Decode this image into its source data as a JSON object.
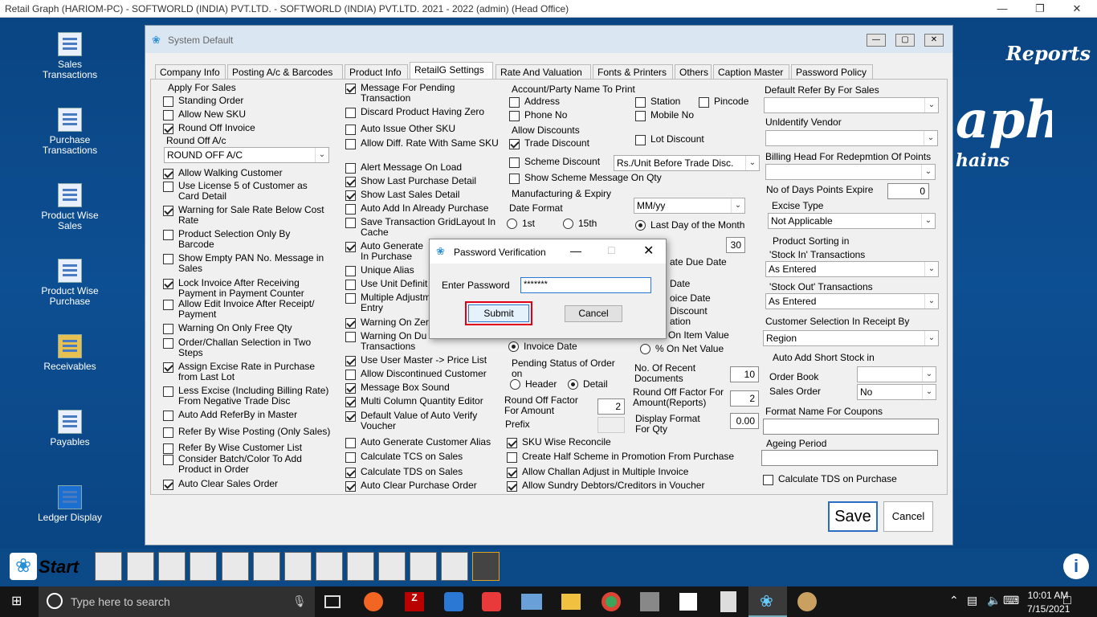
{
  "window": {
    "title": "Retail Graph (HARIOM-PC) - SOFTWORLD (INDIA) PVT.LTD. - SOFTWORLD (INDIA) PVT.LTD.  2021 - 2022 (admin) (Head Office)"
  },
  "desktop": {
    "icons": [
      {
        "label": "Sales Transactions",
        "icon": "document-icon"
      },
      {
        "label": "Purchase Transactions",
        "icon": "document-icon"
      },
      {
        "label": "Product Wise Sales",
        "icon": "document-icon"
      },
      {
        "label": "Product Wise Purchase",
        "icon": "document-icon"
      },
      {
        "label": "Receivables",
        "icon": "coins-icon"
      },
      {
        "label": "Payables",
        "icon": "grid-icon"
      },
      {
        "label": "Ledger Display",
        "icon": "ledger-icon"
      }
    ],
    "brand": "Reports",
    "bigtext": "aph",
    "subtext": "hains"
  },
  "dialog": {
    "title": "System Default",
    "tabs": [
      "Company Info",
      "Posting A/c & Barcodes",
      "Product Info",
      "RetailG Settings",
      "Rate And Valuation",
      "Fonts & Printers",
      "Others",
      "Caption Master",
      "Password Policy"
    ],
    "col1": {
      "apply_for_sales": "Apply For Sales",
      "standing_order": "Standing Order",
      "allow_new_sku": "Allow New SKU",
      "round_off_invoice": "Round Off Invoice",
      "round_off_ac": "Round Off A/c",
      "round_off_ac_value": "ROUND OFF A/C",
      "allow_walking": "Allow Walking Customer",
      "use_license": "Use License 5 of Customer as Card Detail",
      "warning_sale_rate": "Warning for Sale Rate Below Cost Rate",
      "product_selection": "Product Selection Only By Barcode",
      "show_empty_pan": "Show Empty PAN No. Message in Sales",
      "lock_invoice": "Lock Invoice After Receiving Payment in Payment Counter",
      "allow_edit_invoice": "Allow Edit Invoice After Receipt/ Payment",
      "warning_free_qty": "Warning On Only Free Qty",
      "order_challan": "Order/Challan Selection in Two Steps",
      "assign_excise": "Assign Excise Rate in Purchase from Last Lot",
      "less_excise": "Less Excise (Including Billing Rate) From Negative Trade Disc",
      "auto_add_referby": "Auto Add ReferBy in Master",
      "refer_by_wise": "Refer By Wise Posting (Only Sales)",
      "refer_customer_list": "Refer By Wise Customer List",
      "consider_batch": "Consider Batch/Color To Add Product in Order",
      "auto_clear_sales": "Auto Clear Sales Order"
    },
    "col2": {
      "msg_pending": "Message For Pending Transaction",
      "discard_product": "Discard Product Having Zero",
      "auto_issue_sku": "Auto Issue Other SKU",
      "allow_diff_rate": "Allow Diff. Rate With Same SKU",
      "alert_on_load": "Alert Message On Load",
      "show_last_purchase": "Show Last Purchase Detail",
      "show_last_sales": "Show Last Sales Detail",
      "auto_add_purchase": "Auto Add In Already Purchase",
      "save_grid": "Save Transaction GridLayout In Cache",
      "auto_generate": "Auto Generate In Purchase",
      "unique_alias": "Unique Alias",
      "use_unit": "Use Unit Definit",
      "multiple_adjust": "Multiple Adjustm Entry",
      "warning_zero": "Warning On Zer",
      "warning_du": "Warning On Du in Transactions",
      "user_master": "Use User Master -> Price List",
      "allow_discontinued": "Allow Discontinued Customer",
      "msg_box_sound": "Message Box Sound",
      "multi_column": "Multi Column Quantity Editor",
      "default_auto_verify": "Default Value of Auto Verify Voucher",
      "auto_gen_alias": "Auto Generate Customer Alias",
      "calc_tcs": "Calculate TCS on Sales",
      "calc_tds": "Calculate TDS on Sales",
      "auto_clear_purchase": "Auto Clear Purchase Order"
    },
    "col3": {
      "acct_party": "Account/Party Name To Print",
      "address": "Address",
      "station": "Station",
      "pincode": "Pincode",
      "phone": "Phone No",
      "mobile": "Mobile No",
      "allow_discounts": "Allow Discounts",
      "trade_discount": "Trade Discount",
      "lot_discount": "Lot Discount",
      "scheme_discount": "Scheme Discount",
      "scheme_discount_value": "Rs./Unit Before Trade Disc.",
      "show_scheme": "Show Scheme Message On Qty",
      "mfg_expiry": "Manufacturing & Expiry",
      "date_format": "Date Format",
      "date_format_value": "MM/yy",
      "r1st": "1st",
      "r15th": "15th",
      "last_day": "Last  Day of the Month",
      "days_value": "30",
      "ate_due_date": "ate Due Date",
      "date": "Date",
      "oice_date": "oice Date",
      "discount": "Discount",
      "ation": "ation",
      "on_item_value": "On Item Value",
      "on_net_value": "% On Net Value",
      "invoice_date": "Invoice Date",
      "pending_status": "Pending Status of Order on",
      "header": "Header",
      "detail": "Detail",
      "round_off_amount": "Round Off Factor For Amount",
      "round_off_amount_value": "2",
      "prefix": "Prefix",
      "recent_docs": "No. Of Recent Documents",
      "recent_docs_value": "10",
      "round_off_reports": "Round Off Factor For Amount(Reports)",
      "round_off_reports_value": "2",
      "display_format": "Display Format For Qty",
      "display_format_value": "0.00",
      "sku_wise": "SKU Wise Reconcile",
      "half_scheme": "Create Half Scheme in Promotion From Purchase",
      "allow_challan": "Allow Challan Adjust in Multiple Invoice",
      "allow_sundry": "Allow Sundry Debtors/Creditors in Voucher"
    },
    "col4": {
      "default_refer": "Default Refer By For Sales",
      "unidentify_vendor": "Unldentify Vendor",
      "billing_head": "Billing Head For Redepmtion Of Points",
      "days_expire": "No of Days Points Expire",
      "days_expire_value": "0",
      "excise_type": "Excise Type",
      "excise_value": "Not Applicable",
      "product_sorting": "Product Sorting in",
      "stock_in": "'Stock In' Transactions",
      "stock_in_value": "As Entered",
      "stock_out": "'Stock Out' Transactions",
      "stock_out_value": "As Entered",
      "customer_selection": "Customer Selection In Receipt By",
      "customer_selection_value": "Region",
      "auto_add_short": "Auto Add Short Stock in",
      "order_book": "Order Book",
      "sales_order": "Sales Order",
      "sales_order_value": "No",
      "format_coupons": "Format Name For Coupons",
      "ageing_period": "Ageing Period",
      "calc_tds_purchase": "Calculate TDS on Purchase"
    },
    "save": "Save",
    "cancel": "Cancel"
  },
  "password_dialog": {
    "title": "Password Verification",
    "label": "Enter Password",
    "value": "*******",
    "submit": "Submit",
    "cancel": "Cancel"
  },
  "taskbar": {
    "start": "Start",
    "search_placeholder": "Type here to search",
    "time": "10:01 AM",
    "date": "7/15/2021"
  }
}
